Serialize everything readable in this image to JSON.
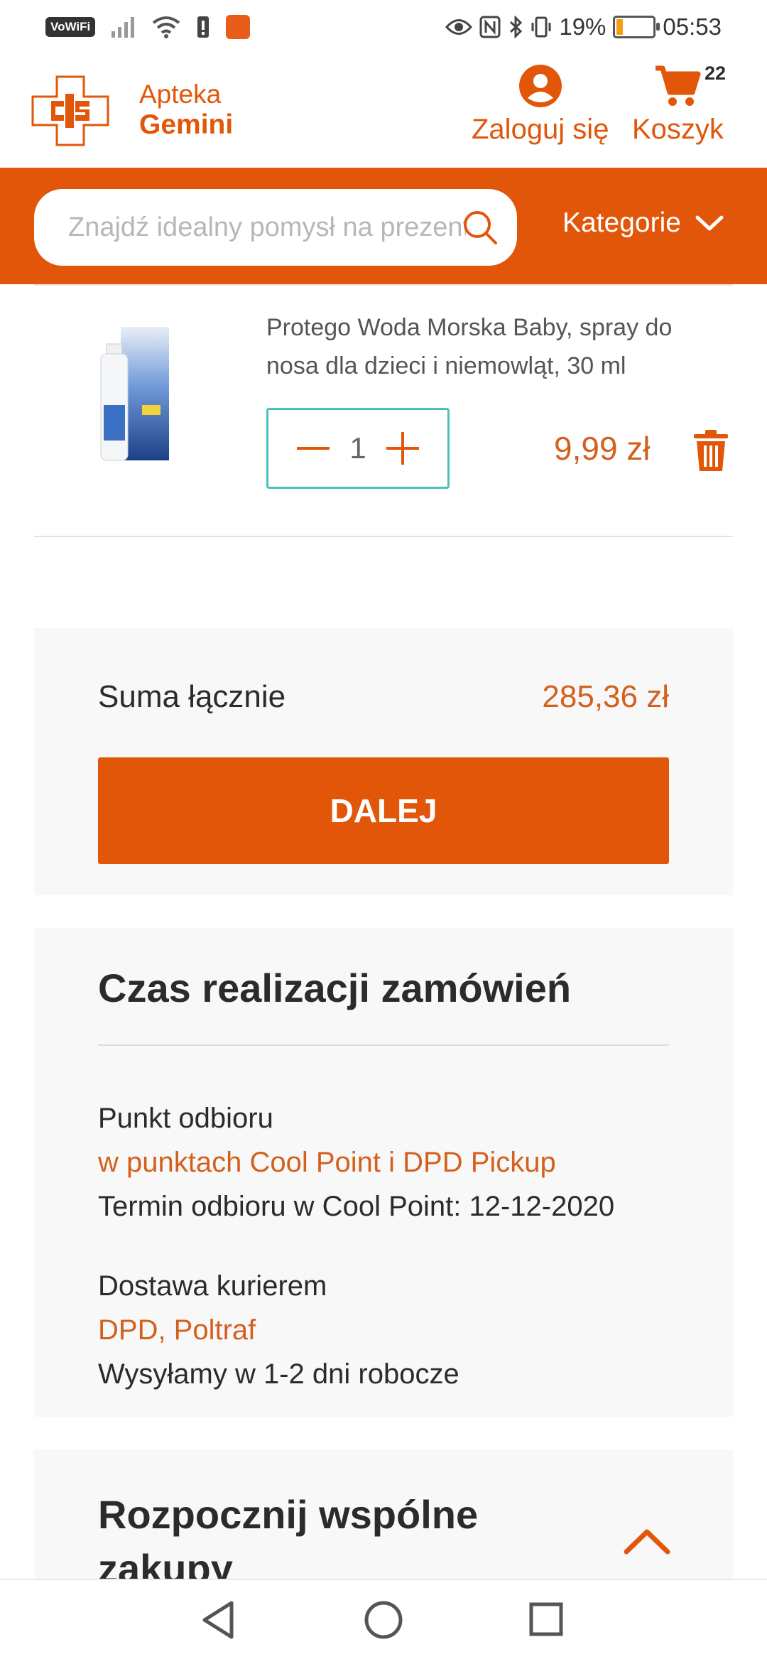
{
  "status_bar": {
    "vowifi": "VoWiFi",
    "battery_percent": "19%",
    "battery_level": 0.19,
    "time": "05:53"
  },
  "header": {
    "brand_line1": "Apteka",
    "brand_line2": "Gemini",
    "login_label": "Zaloguj się",
    "cart_label": "Koszyk",
    "cart_count": "22"
  },
  "search": {
    "placeholder": "Znajdź idealny pomysł na prezent",
    "categories_label": "Kategorie"
  },
  "cart_item": {
    "name": "Protego Woda Morska Baby, spray do nosa dla dzieci i niemowląt, 30 ml",
    "quantity": "1",
    "price": "9,99 zł"
  },
  "summary": {
    "total_label": "Suma łącznie",
    "total_value": "285,36 zł",
    "next_button": "DALEJ"
  },
  "delivery": {
    "title": "Czas realizacji zamówień",
    "pickup_label": "Punkt odbioru",
    "pickup_link": "w punktach Cool Point i DPD Pickup",
    "pickup_term": "Termin odbioru w Cool Point: 12-12-2020",
    "courier_label": "Dostawa kurierem",
    "courier_link": "DPD, Poltraf",
    "courier_note": "Wysyłamy w 1-2 dni robocze"
  },
  "group_shopping": {
    "title": "Rozpocznij wspólne zakupy"
  },
  "colors": {
    "accent": "#e2560a",
    "price": "#d4601d",
    "qty_border": "#4cc0bd"
  }
}
